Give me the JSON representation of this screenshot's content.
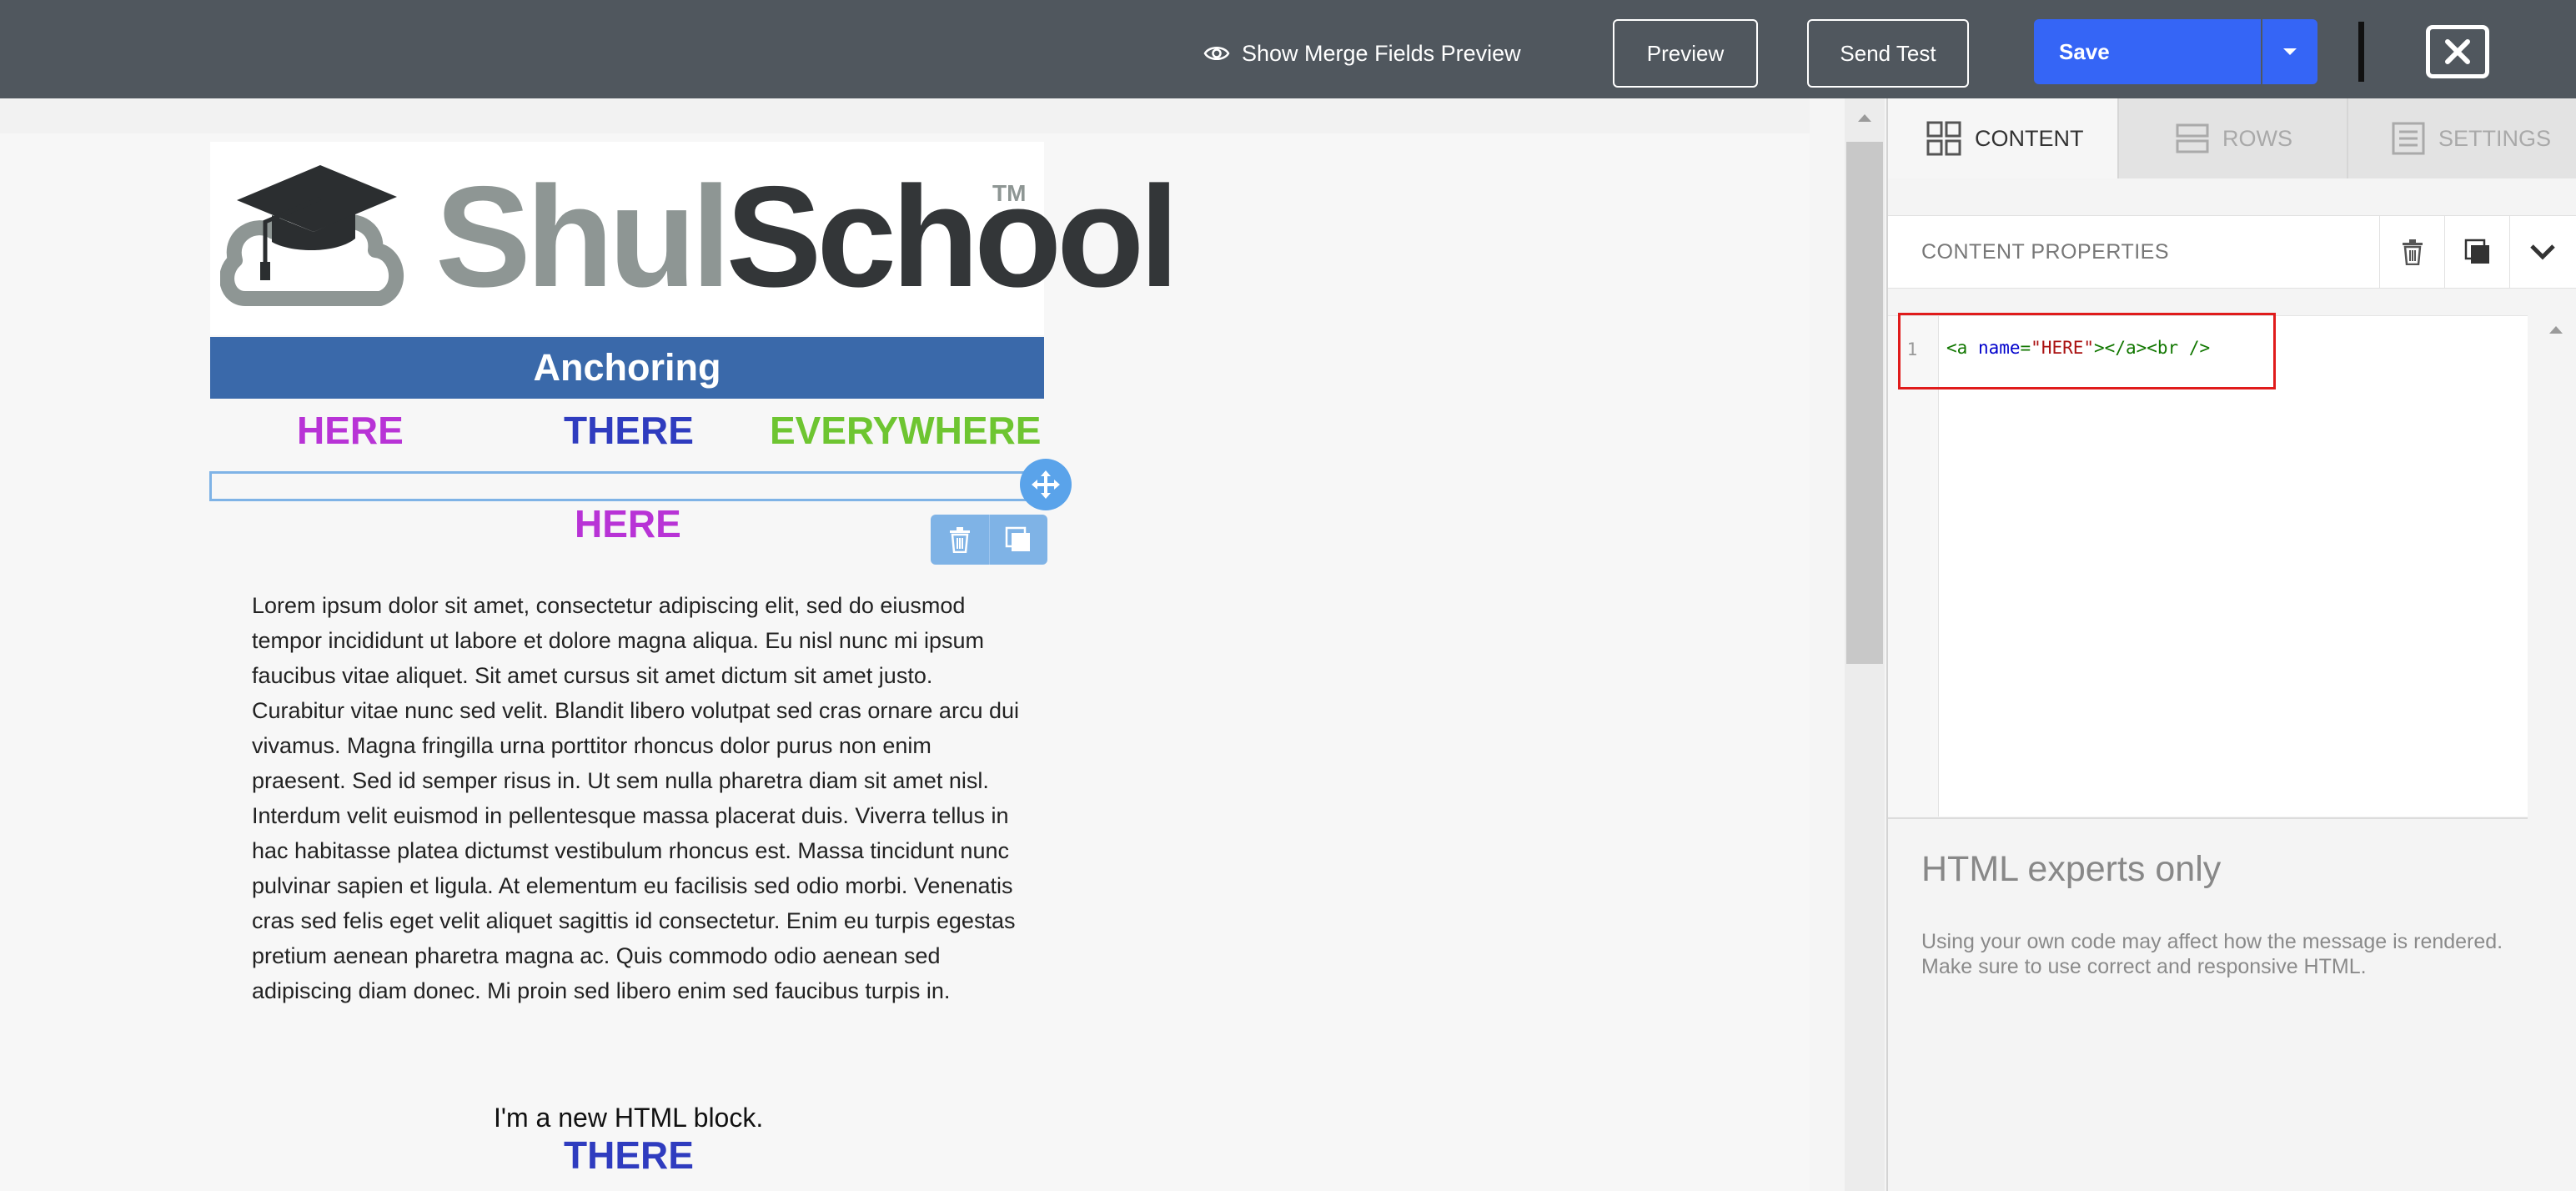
{
  "toolbar": {
    "merge_preview_label": "Show Merge Fields Preview",
    "preview_label": "Preview",
    "send_test_label": "Send Test",
    "save_label": "Save",
    "close_icon": "close-x-icon"
  },
  "email": {
    "logo": {
      "shul": "Shul",
      "school": "School",
      "tm": "TM"
    },
    "banner_title": "Anchoring",
    "nav": {
      "here": "HERE",
      "there": "THERE",
      "everywhere": "EVERYWHERE"
    },
    "heading_here": "HERE",
    "lorem": "Lorem ipsum dolor sit amet, consectetur adipiscing elit, sed do eiusmod tempor incididunt ut labore et dolore magna aliqua. Eu nisl nunc mi ipsum faucibus vitae aliquet. Sit amet cursus sit amet dictum sit amet justo. Curabitur vitae nunc sed velit. Blandit libero volutpat sed cras ornare arcu dui vivamus. Magna fringilla urna porttitor rhoncus dolor purus non enim praesent. Sed id semper risus in. Ut sem nulla pharetra diam sit amet nisl. Interdum velit euismod in pellentesque massa placerat duis. Viverra tellus in hac habitasse platea dictumst vestibulum rhoncus est. Massa tincidunt nunc pulvinar sapien et ligula. At elementum eu facilisis sed odio morbi. Venenatis cras sed felis eget velit aliquet sagittis id consectetur. Enim eu turpis egestas pretium aenean pharetra magna ac. Quis commodo odio aenean sed adipiscing diam donec. Mi proin sed libero enim sed faucibus turpis in.",
    "new_block_text": "I'm a new HTML block.",
    "heading_there": "THERE"
  },
  "panel": {
    "tabs": [
      {
        "label": "CONTENT",
        "active": true
      },
      {
        "label": "ROWS",
        "active": false
      },
      {
        "label": "SETTINGS",
        "active": false
      }
    ],
    "content_properties_title": "CONTENT PROPERTIES",
    "editor": {
      "line_number": "1",
      "code": {
        "open_tag": "<a ",
        "attr_name": "name",
        "equals": "=",
        "attr_value": "\"HERE\"",
        "rest": "></a><br />"
      }
    },
    "experts_title": "HTML experts only",
    "experts_note": "Using your own code may affect how the message is rendered. Make sure to use correct and responsive HTML."
  },
  "colors": {
    "topbar": "#50575e",
    "save_blue": "#3565f6",
    "banner_blue": "#3a69aa",
    "here_purple": "#b833d6",
    "there_blue": "#2f3cbf",
    "everywhere_green": "#6ec531",
    "highlight_red": "#e01b1b"
  }
}
